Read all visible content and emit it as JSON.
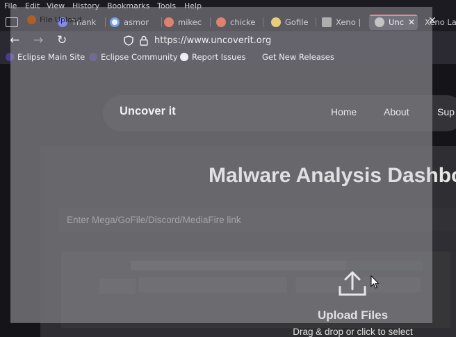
{
  "menu": [
    "File",
    "Edit",
    "View",
    "History",
    "Bookmarks",
    "Tools",
    "Help"
  ],
  "tabs": [
    {
      "label": "Thank",
      "icon": "discord-icon",
      "color": "#5865f2"
    },
    {
      "label": "asmor",
      "icon": "google-icon",
      "color": "#4285f4"
    },
    {
      "label": "mikec",
      "icon": "duckduckgo-icon",
      "color": "#de5833"
    },
    {
      "label": "chicke",
      "icon": "duckduckgo-icon",
      "color": "#de5833"
    },
    {
      "label": "Gofile",
      "icon": "gofile-icon",
      "color": "#f2c94c"
    },
    {
      "label": "Xeno |",
      "icon": "xeno-icon",
      "color": "#9a9a9a"
    },
    {
      "label": "Unc",
      "icon": "uncoverit-icon",
      "color": "#bbbbbb"
    },
    {
      "label": "Xeno La",
      "icon": "",
      "color": ""
    }
  ],
  "dialog": {
    "title": "File Upload"
  },
  "urlbar": {
    "url": "https://www.uncoverit.org"
  },
  "bookmarks": [
    "Eclipse Main Site",
    "Eclipse Community",
    "Report Issues",
    "Get New Releases"
  ],
  "site": {
    "brand": "Uncover it",
    "nav": [
      "Home",
      "About",
      "Sup"
    ],
    "title": "Malware Analysis Dashbo",
    "input_placeholder": "Enter Mega/GoFile/Discord/MediaFire link",
    "upload_title": "Upload Files",
    "upload_subtitle": "Drag & drop or click to select"
  },
  "colors": {
    "accent": "#f5637e",
    "page_bg": "#2a2a2e"
  }
}
